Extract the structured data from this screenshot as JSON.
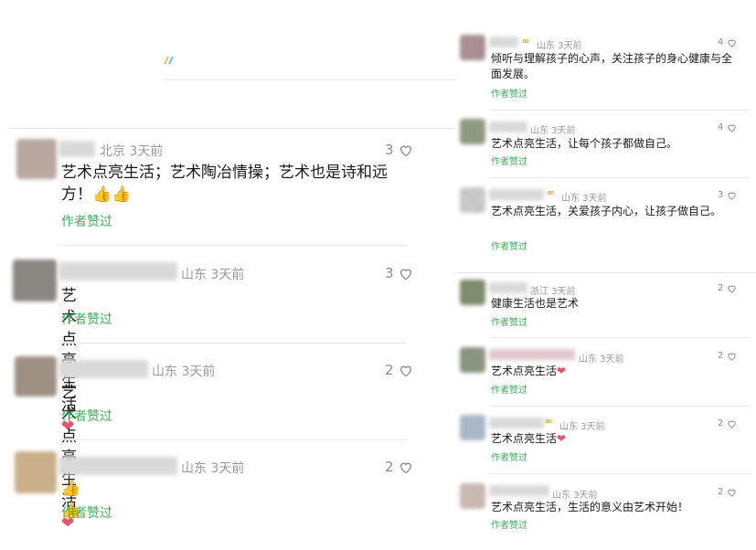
{
  "colors": {
    "accent_green": "#3ab05a",
    "meta_gray": "#9b9b9b",
    "heart": "#e8546a",
    "badge_gold": "#e0a020"
  },
  "icons": {
    "like": "heart-outline-icon",
    "badge": "infinity-badge-icon"
  },
  "liked_label": "作者赞过",
  "left_comments": [
    {
      "location": "北京 3天前",
      "likes": "3",
      "text": "艺术点亮生活；艺术陶冶情操；艺术也是诗和远方！",
      "emoji": "👍👍",
      "liked": "作者赞过"
    },
    {
      "location": "山东 3天前",
      "likes": "3",
      "text": "艺术点亮生活",
      "emoji": "❤",
      "liked": "作者赞过"
    },
    {
      "location": "山东 3天前",
      "likes": "2",
      "text": "艺术点亮生活",
      "emoji": "❤",
      "liked": "作者赞过"
    },
    {
      "location": "山东 3天前",
      "likes": "2",
      "text": "",
      "emoji": "👍👍",
      "liked": "作者赞过"
    }
  ],
  "right_comments": [
    {
      "location": "山东 3天前",
      "likes": "4",
      "text": "倾听与理解孩子的心声，关注孩子的身心健康与全面发展。",
      "emoji": "",
      "liked": "作者赞过"
    },
    {
      "location": "山东 3天前",
      "likes": "4",
      "text": "艺术点亮生活，让每个孩子都做自己。",
      "emoji": "",
      "liked": "作者赞过"
    },
    {
      "location": "山东 3天前",
      "likes": "3",
      "text": "艺术点亮生活，关爱孩子内心，让孩子做自己。",
      "emoji": "",
      "liked": "作者赞过"
    },
    {
      "location": "浙江 3天前",
      "likes": "2",
      "text": "健康生活也是艺术",
      "emoji": "",
      "liked": "作者赞过"
    },
    {
      "location": "山东 3天前",
      "likes": "2",
      "text": "艺术点亮生活",
      "emoji": "❤",
      "liked": "作者赞过"
    },
    {
      "location": "山东 3天前",
      "likes": "2",
      "text": "艺术点亮生活",
      "emoji": "❤",
      "liked": "作者赞过"
    },
    {
      "location": "山东 3天前",
      "likes": "2",
      "text": "艺术点亮生活，生活的意义由艺术开始！",
      "emoji": "",
      "liked": "作者赞过"
    }
  ]
}
